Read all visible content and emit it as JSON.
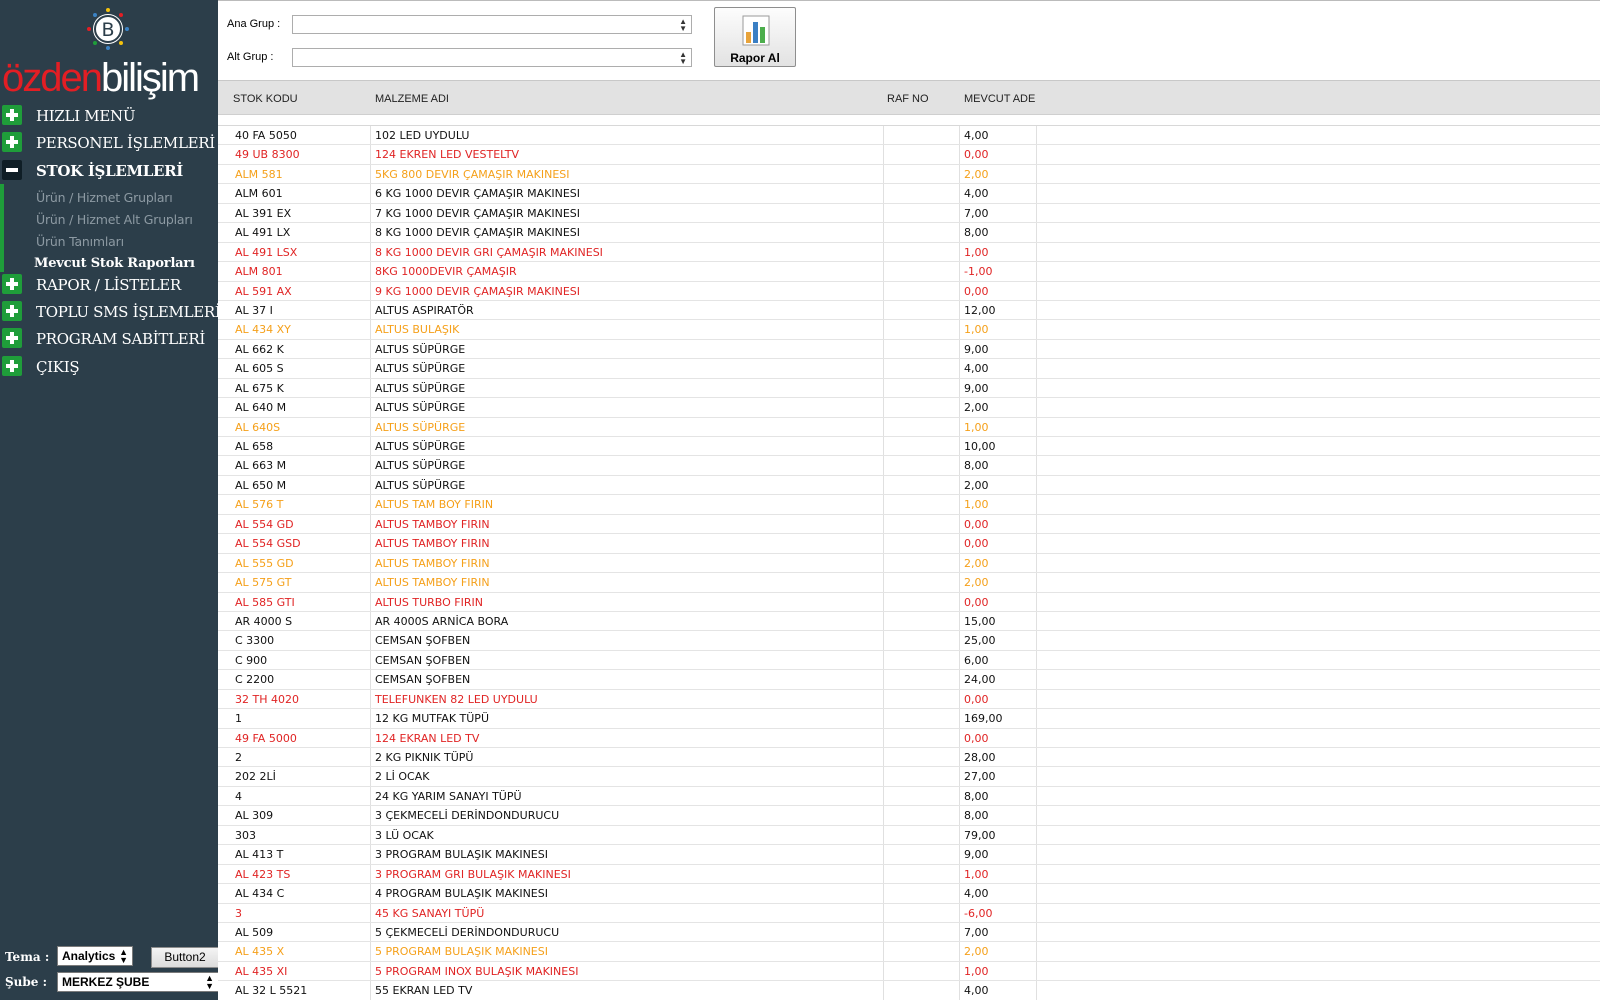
{
  "brand": {
    "logo_letter": "B",
    "name_red": "özden",
    "name_white": "bilişim"
  },
  "sidebar": {
    "menu": [
      {
        "label": "HIZLI MENÜ",
        "icon": "plus-icon"
      },
      {
        "label": "PERSONEL İŞLEMLERİ",
        "icon": "plus-icon"
      },
      {
        "label": "STOK İŞLEMLERİ",
        "icon": "minus-icon"
      },
      {
        "label": "RAPOR / LİSTELER",
        "icon": "plus-icon"
      },
      {
        "label": "TOPLU SMS İŞLEMLERİ",
        "icon": "plus-icon"
      },
      {
        "label": "PROGRAM SABİTLERİ",
        "icon": "plus-icon"
      },
      {
        "label": "ÇIKIŞ",
        "icon": "plus-icon"
      }
    ],
    "submenu": [
      {
        "label": "Ürün / Hizmet Grupları"
      },
      {
        "label": "Ürün / Hizmet Alt Grupları"
      },
      {
        "label": "Ürün Tanımları"
      },
      {
        "label": "Mevcut Stok Raporları"
      }
    ],
    "theme_label": "Tema :",
    "theme_value": "Analytics",
    "button2_label": "Button2",
    "branch_label": "Şube :",
    "branch_value": "MERKEZ ŞUBE"
  },
  "filters": {
    "ana_grup_label": "Ana Grup :",
    "ana_grup_value": "",
    "alt_grup_label": "Alt Grup :",
    "alt_grup_value": "",
    "report_button_label": "Rapor Al"
  },
  "grid": {
    "columns": [
      "STOK KODU",
      "MALZEME ADI",
      "RAF NO",
      "MEVCUT ADE"
    ],
    "rows": [
      {
        "code": "40 FA 5050",
        "name": "102 LED UYDULU",
        "raf": "",
        "qty": "4,00",
        "status": "normal"
      },
      {
        "code": "49 UB 8300",
        "name": "124 EKREN LED  VESTELTV",
        "raf": "",
        "qty": "0,00",
        "status": "red"
      },
      {
        "code": "ALM 581",
        "name": "5KG 800 DEVIR ÇAMAŞIR MAKINESI",
        "raf": "",
        "qty": "2,00",
        "status": "orange"
      },
      {
        "code": "ALM 601",
        "name": "6 KG 1000 DEVIR ÇAMAŞIR MAKINESI",
        "raf": "",
        "qty": "4,00",
        "status": "normal"
      },
      {
        "code": "AL 391 EX",
        "name": "7 KG 1000 DEVIR ÇAMAŞIR MAKINESI",
        "raf": "",
        "qty": "7,00",
        "status": "normal"
      },
      {
        "code": "AL 491 LX",
        "name": "8 KG 1000 DEVIR ÇAMAŞIR MAKINESI",
        "raf": "",
        "qty": "8,00",
        "status": "normal"
      },
      {
        "code": "AL 491 LSX",
        "name": "8 KG 1000 DEVIR GRI ÇAMAŞIR MAKINESI",
        "raf": "",
        "qty": "1,00",
        "status": "red"
      },
      {
        "code": "ALM 801",
        "name": "8KG 1000DEVIR ÇAMAŞIR",
        "raf": "",
        "qty": "-1,00",
        "status": "red"
      },
      {
        "code": "AL 591 AX",
        "name": "9 KG 1000 DEVIR ÇAMAŞIR MAKINESI",
        "raf": "",
        "qty": "0,00",
        "status": "red"
      },
      {
        "code": "AL 37 I",
        "name": "ALTUS ASPIRATÖR",
        "raf": "",
        "qty": "12,00",
        "status": "normal"
      },
      {
        "code": "AL 434 XY",
        "name": "ALTUS BULAŞIK",
        "raf": "",
        "qty": "1,00",
        "status": "orange"
      },
      {
        "code": "AL 662 K",
        "name": "ALTUS SÜPÜRGE",
        "raf": "",
        "qty": "9,00",
        "status": "normal"
      },
      {
        "code": "AL 605 S",
        "name": "ALTUS SÜPÜRGE",
        "raf": "",
        "qty": "4,00",
        "status": "normal"
      },
      {
        "code": "AL 675 K",
        "name": "ALTUS SÜPÜRGE",
        "raf": "",
        "qty": "9,00",
        "status": "normal"
      },
      {
        "code": "AL 640 M",
        "name": "ALTUS SÜPÜRGE",
        "raf": "",
        "qty": "2,00",
        "status": "normal"
      },
      {
        "code": "AL 640S",
        "name": "ALTUS SÜPÜRGE",
        "raf": "",
        "qty": "1,00",
        "status": "orange"
      },
      {
        "code": "AL 658",
        "name": "ALTUS SÜPÜRGE",
        "raf": "",
        "qty": "10,00",
        "status": "normal"
      },
      {
        "code": "AL 663 M",
        "name": "ALTUS SÜPÜRGE",
        "raf": "",
        "qty": "8,00",
        "status": "normal"
      },
      {
        "code": "AL 650 M",
        "name": "ALTUS SÜPÜRGE",
        "raf": "",
        "qty": "2,00",
        "status": "normal"
      },
      {
        "code": "AL 576 T",
        "name": "ALTUS TAM BOY FIRIN",
        "raf": "",
        "qty": "1,00",
        "status": "orange"
      },
      {
        "code": "AL 554 GD",
        "name": "ALTUS TAMBOY FIRIN",
        "raf": "",
        "qty": "0,00",
        "status": "red"
      },
      {
        "code": "AL 554 GSD",
        "name": "ALTUS TAMBOY FIRIN",
        "raf": "",
        "qty": "0,00",
        "status": "red"
      },
      {
        "code": "AL 555 GD",
        "name": "ALTUS TAMBOY FIRIN",
        "raf": "",
        "qty": "2,00",
        "status": "orange"
      },
      {
        "code": "AL 575 GT",
        "name": "ALTUS TAMBOY FIRIN",
        "raf": "",
        "qty": "2,00",
        "status": "orange"
      },
      {
        "code": "AL 585 GTI",
        "name": "ALTUS TURBO FIRIN",
        "raf": "",
        "qty": "0,00",
        "status": "red"
      },
      {
        "code": "AR 4000 S",
        "name": "AR 4000S  ARNİCA BORA",
        "raf": "",
        "qty": "15,00",
        "status": "normal"
      },
      {
        "code": "C 3300",
        "name": "CEMSAN ŞOFBEN",
        "raf": "",
        "qty": "25,00",
        "status": "normal"
      },
      {
        "code": "C 900",
        "name": "CEMSAN ŞOFBEN",
        "raf": "",
        "qty": "6,00",
        "status": "normal"
      },
      {
        "code": "C 2200",
        "name": "CEMSAN ŞOFBEN",
        "raf": "",
        "qty": "24,00",
        "status": "normal"
      },
      {
        "code": "32 TH 4020",
        "name": "TELEFUNKEN 82 LED UYDULU",
        "raf": "",
        "qty": "0,00",
        "status": "red"
      },
      {
        "code": "1",
        "name": "12 KG MUTFAK TÜPÜ",
        "raf": "",
        "qty": "169,00",
        "status": "normal"
      },
      {
        "code": "49 FA 5000",
        "name": "124 EKRAN LED TV",
        "raf": "",
        "qty": "0,00",
        "status": "red"
      },
      {
        "code": "2",
        "name": "2 KG PIKNIK TÜPÜ",
        "raf": "",
        "qty": "28,00",
        "status": "normal"
      },
      {
        "code": "202 2Lİ",
        "name": "2 Lİ OCAK",
        "raf": "",
        "qty": "27,00",
        "status": "normal"
      },
      {
        "code": "4",
        "name": "24 KG YARIM SANAYI TÜPÜ",
        "raf": "",
        "qty": "8,00",
        "status": "normal"
      },
      {
        "code": "AL 309",
        "name": "3 ÇEKMECELİ DERİNDONDURUCU",
        "raf": "",
        "qty": "8,00",
        "status": "normal"
      },
      {
        "code": "303",
        "name": "3 LÜ OCAK",
        "raf": "",
        "qty": "79,00",
        "status": "normal"
      },
      {
        "code": "AL 413 T",
        "name": "3 PROGRAM BULAŞIK MAKINESI",
        "raf": "",
        "qty": "9,00",
        "status": "normal"
      },
      {
        "code": "AL 423 TS",
        "name": "3 PROGRAM GRI BULAŞIK MAKINESI",
        "raf": "",
        "qty": "1,00",
        "status": "red"
      },
      {
        "code": "AL 434 C",
        "name": "4 PROGRAM BULAŞIK MAKINESI",
        "raf": "",
        "qty": "4,00",
        "status": "normal"
      },
      {
        "code": "3",
        "name": "45 KG SANAYI TÜPÜ",
        "raf": "",
        "qty": "-6,00",
        "status": "red"
      },
      {
        "code": "AL 509",
        "name": "5 ÇEKMECELİ DERİNDONDURUCU",
        "raf": "",
        "qty": "7,00",
        "status": "normal"
      },
      {
        "code": "AL 435 X",
        "name": "5 PROGRAM BULAŞIK MAKINESI",
        "raf": "",
        "qty": "2,00",
        "status": "orange"
      },
      {
        "code": "AL 435 XI",
        "name": "5 PROGRAM INOX BULAŞIK MAKINESI",
        "raf": "",
        "qty": "1,00",
        "status": "red"
      },
      {
        "code": "AL 32 L 5521",
        "name": "55 EKRAN LED TV",
        "raf": "",
        "qty": "4,00",
        "status": "normal"
      }
    ]
  },
  "colors": {
    "sidebar_bg": "#2c3e4a",
    "accent_green": "#1f9d3a",
    "row_red": "#e02424",
    "row_orange": "#f5a01a",
    "brand_red": "#e31e24"
  }
}
